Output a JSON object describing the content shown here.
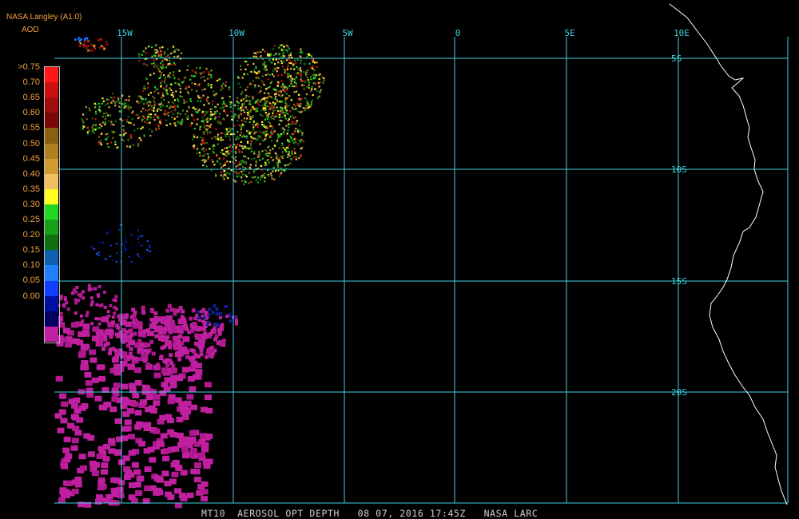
{
  "header": {
    "source": "NASA Langley (A1.0)",
    "product": "AOD"
  },
  "legend": {
    "labels": [
      ">0.75",
      "0.70",
      "0.65",
      "0.60",
      "0.55",
      "0.50",
      "0.45",
      "0.40",
      "0.35",
      "0.30",
      "0.25",
      "0.20",
      "0.15",
      "0.10",
      "0.05",
      "0.00"
    ],
    "colors": [
      "#ff1818",
      "#cc1010",
      "#a00c0c",
      "#7a0808",
      "#8a6010",
      "#b08020",
      "#d09a30",
      "#f0c060",
      "#ffff20",
      "#20d820",
      "#18a018",
      "#107010",
      "#1060b0",
      "#2080ff",
      "#1040ff",
      "#0010a0",
      "#000060",
      "#c020a0"
    ]
  },
  "map": {
    "lon_labels": [
      "15W",
      "10W",
      "5W",
      "0",
      "5E",
      "10E"
    ],
    "lat_labels": [
      "5S",
      "10S",
      "15S",
      "20S"
    ],
    "grid_color": "#40d0e0",
    "coast_color": "#ffffff",
    "aerosol_low_color": "#c020a0"
  },
  "footer": {
    "text": "MT10  AEROSOL OPT DEPTH   08 07, 2016 17:45Z   NASA LARC"
  }
}
